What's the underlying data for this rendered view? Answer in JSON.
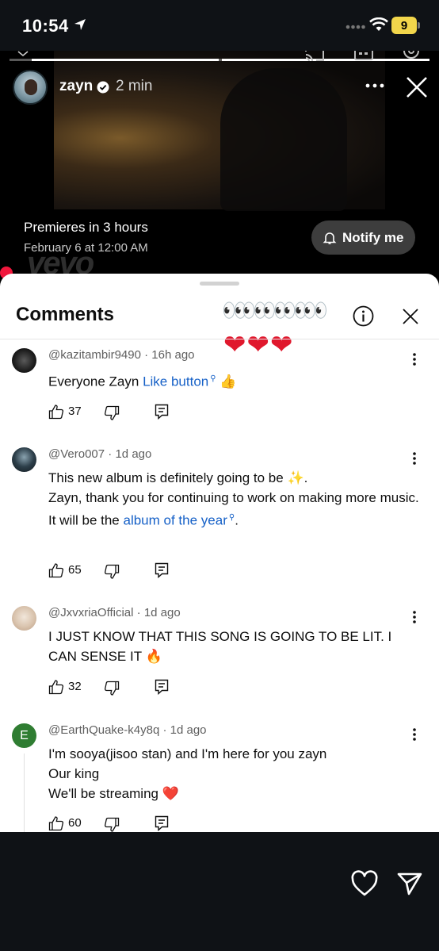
{
  "status_bar": {
    "time": "10:54",
    "battery": "9"
  },
  "story": {
    "username": "zayn",
    "time_ago": "2 min",
    "premiere_text": "Premieres in 3 hours",
    "premiere_date": "February 6 at 12:00 AM",
    "watermark": "vevo",
    "notify_label": "Notify me"
  },
  "comments_sheet": {
    "title": "Comments",
    "eyes_sticker": "👀👀👀👀👀",
    "hearts_sticker": "❤❤❤"
  },
  "comments": [
    {
      "author": "@kazitambir9490",
      "time": "16h ago",
      "text_before": "Everyone Zayn ",
      "link": "Like button",
      "text_after": " 👍",
      "likes": "37"
    },
    {
      "author": "@Vero007",
      "time": "1d ago",
      "line1": "This new album is definitely going to be ✨.",
      "line2": "Zayn, thank you for continuing to work on making more music.",
      "line3_before": "It will be the ",
      "link": "album of the year",
      "line3_after": ".",
      "likes": "65"
    },
    {
      "author": "@JxvxriaOfficial",
      "time": "1d ago",
      "text": "I JUST KNOW THAT THIS SONG IS GOING TO BE LIT. I CAN SENSE IT 🔥",
      "likes": "32"
    },
    {
      "author": "@EarthQuake-k4y8q",
      "time": "1d ago",
      "avatar_letter": "E",
      "line1": "I'm sooya(jisoo stan) and I'm here for you zayn",
      "line2": "Our king",
      "line3": "We'll be streaming ❤️",
      "likes": "60"
    }
  ],
  "colors": {
    "link": "#1560c7",
    "avatar_e": "#2f7d32",
    "heart": "#e0182d"
  }
}
